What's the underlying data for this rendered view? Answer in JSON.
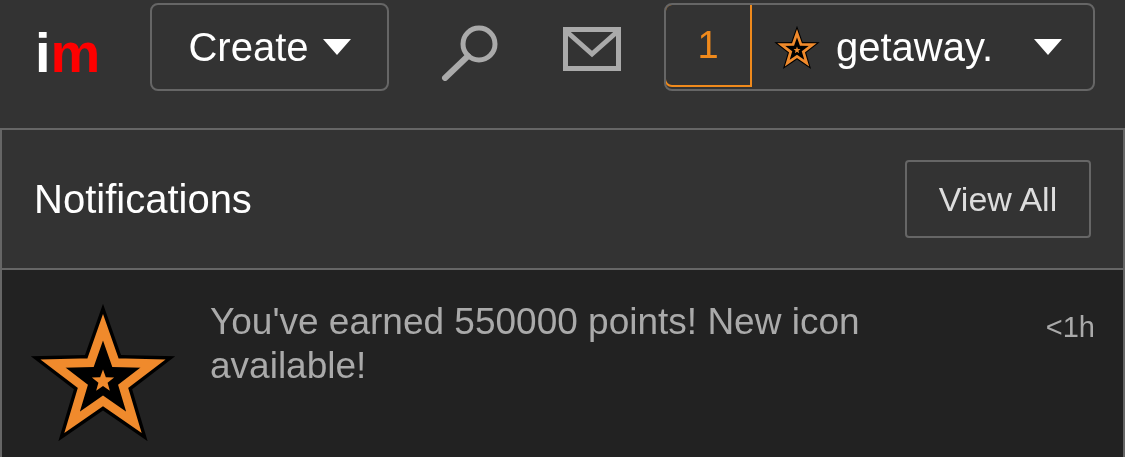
{
  "logo": {
    "letters": [
      "i",
      "m"
    ]
  },
  "header": {
    "create_button": "Create",
    "notification_count": "1",
    "username": "getaway."
  },
  "notifications": {
    "title": "Notifications",
    "view_all": "View All",
    "items": [
      {
        "message": "You've earned 550000 points! New icon available!",
        "time": "<1h"
      }
    ]
  }
}
